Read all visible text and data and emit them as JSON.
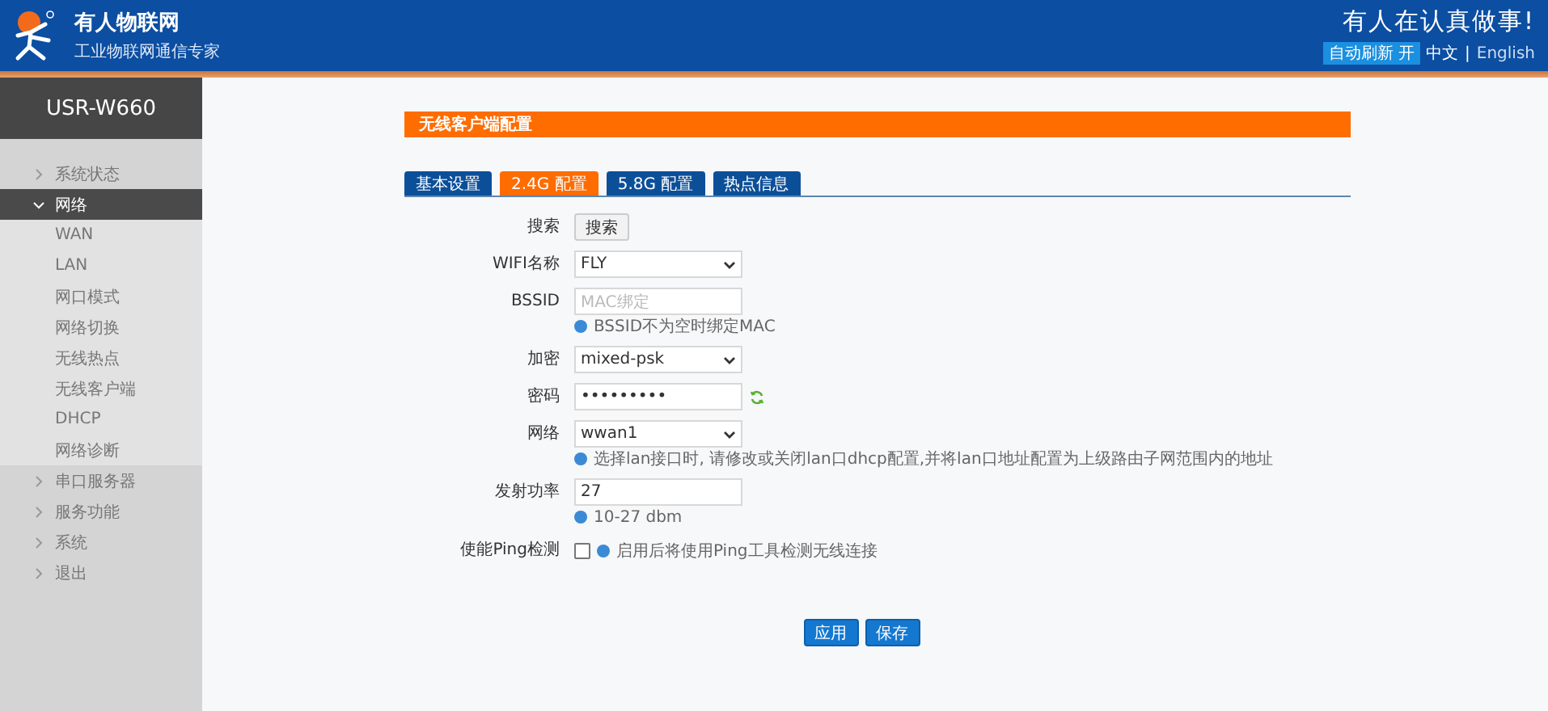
{
  "header": {
    "brand": "有人物联网",
    "tagline": "工业物联网通信专家",
    "slogan": "有人在认真做事!",
    "badge": "自动刷新 开",
    "separator": "|",
    "languages": [
      {
        "label": "中文",
        "selected": true
      },
      {
        "label": "English",
        "selected": false
      }
    ]
  },
  "sidebar": {
    "device": "USR-W660",
    "items": [
      {
        "label": "系统状态",
        "expanded": false
      },
      {
        "label": "网络",
        "expanded": true,
        "children": [
          {
            "label": "WAN"
          },
          {
            "label": "LAN"
          },
          {
            "label": "网口模式"
          },
          {
            "label": "网络切换"
          },
          {
            "label": "无线热点"
          },
          {
            "label": "无线客户端"
          },
          {
            "label": "DHCP"
          },
          {
            "label": "网络诊断"
          }
        ]
      },
      {
        "label": "串口服务器",
        "expanded": false
      },
      {
        "label": "服务功能",
        "expanded": false
      },
      {
        "label": "系统",
        "expanded": false
      },
      {
        "label": "退出",
        "expanded": false
      }
    ]
  },
  "section_title": "无线客户端配置",
  "tabs": [
    {
      "label": "基本设置",
      "selected": false
    },
    {
      "label": "2.4G 配置",
      "selected": true
    },
    {
      "label": "5.8G 配置",
      "selected": false
    },
    {
      "label": "热点信息",
      "selected": false
    }
  ],
  "form": [
    {
      "kind": "button",
      "label": "搜索",
      "button": "搜索"
    },
    {
      "kind": "select",
      "label": "WIFI名称",
      "value": "FLY"
    },
    {
      "kind": "input",
      "label": "BSSID",
      "placeholder": "MAC绑定",
      "hint": "BSSID不为空时绑定MAC"
    },
    {
      "kind": "select",
      "label": "加密",
      "value": "mixed-psk"
    },
    {
      "kind": "password",
      "label": "密码",
      "value": "•••••••••"
    },
    {
      "kind": "select",
      "label": "网络",
      "value": "wwan1",
      "hint": "选择lan接口时, 请修改或关闭lan口dhcp配置,并将lan口地址配置为上级路由子网范围内的地址"
    },
    {
      "kind": "input",
      "label": "发射功率",
      "value": "27",
      "hint": "10-27 dbm"
    },
    {
      "kind": "checkbox",
      "label": "使能Ping检测",
      "checked": false,
      "hint": "启用后将使用Ping工具检测无线连接"
    }
  ],
  "actions": [
    "应用",
    "保存"
  ]
}
